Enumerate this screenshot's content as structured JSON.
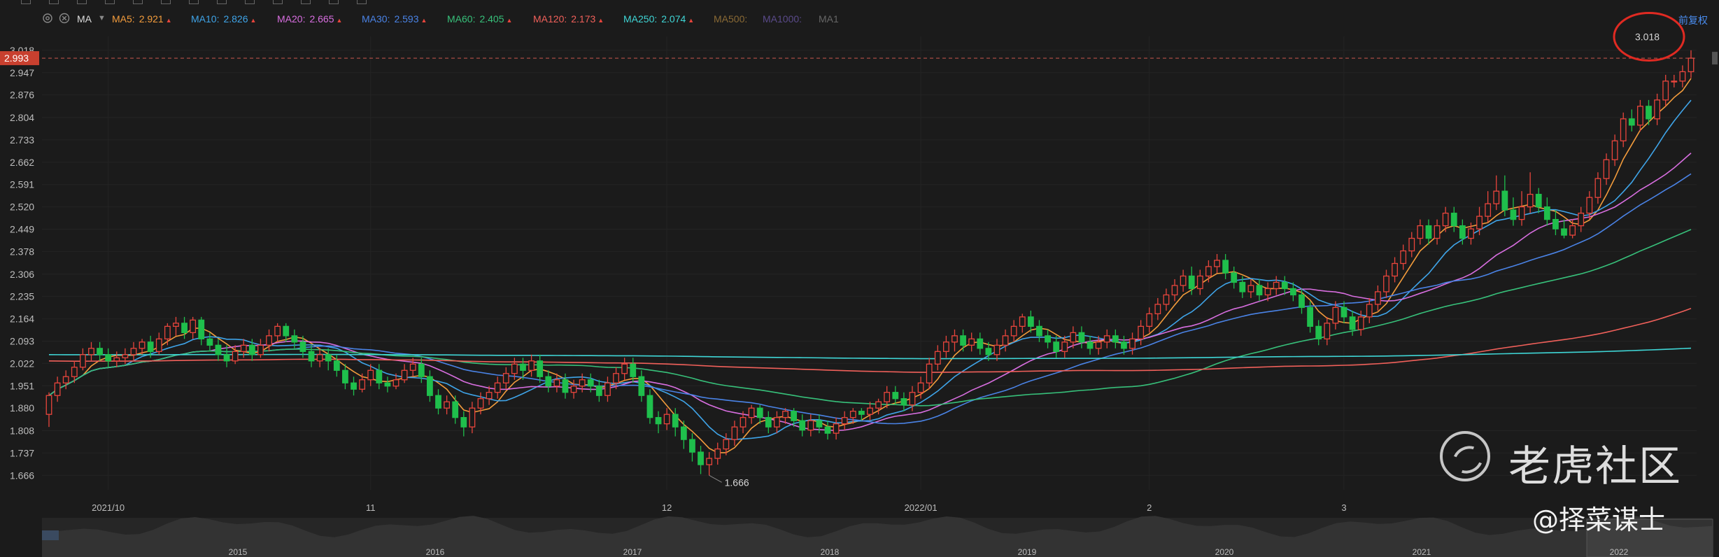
{
  "toolbar": {
    "icons": [
      "pointer-icon",
      "line-icon",
      "trend-icon",
      "shape-icon",
      "text-icon",
      "measure-icon",
      "brush-icon",
      "ruler-icon",
      "zoom-icon",
      "magnet-icon",
      "lock-icon",
      "eye-icon",
      "trash-icon"
    ]
  },
  "ma_bar": {
    "indicator": "MA",
    "items": [
      {
        "label": "MA5:",
        "value": "2.921",
        "color": "#f39c3c",
        "arrow": true
      },
      {
        "label": "MA10:",
        "value": "2.826",
        "color": "#3fa4e8",
        "arrow": true
      },
      {
        "label": "MA20:",
        "value": "2.665",
        "color": "#d86ee0",
        "arrow": true
      },
      {
        "label": "MA30:",
        "value": "2.593",
        "color": "#4a83e6",
        "arrow": true
      },
      {
        "label": "MA60:",
        "value": "2.405",
        "color": "#37c07a",
        "arrow": true
      },
      {
        "label": "MA120:",
        "value": "2.173",
        "color": "#f0605a",
        "arrow": true
      },
      {
        "label": "MA250:",
        "value": "2.074",
        "color": "#3fd6d6",
        "arrow": true
      },
      {
        "label": "MA500:",
        "value": "",
        "color": "#8a6a35",
        "arrow": false
      },
      {
        "label": "MA1000:",
        "value": "",
        "color": "#5a4a8a",
        "arrow": false
      },
      {
        "label": "MA1",
        "value": "",
        "color": "#666666",
        "arrow": false
      }
    ],
    "adjust_label": "前复权"
  },
  "chart_data": {
    "type": "candlestick",
    "yaxis_ticks": [
      "3.018",
      "2.947",
      "2.876",
      "2.804",
      "2.733",
      "2.662",
      "2.591",
      "2.520",
      "2.449",
      "2.378",
      "2.306",
      "2.235",
      "2.164",
      "2.093",
      "2.022",
      "1.951",
      "1.880",
      "1.808",
      "1.737",
      "1.666"
    ],
    "ylim": [
      1.62,
      3.04
    ],
    "current_price": "2.993",
    "high_label": "3.018",
    "low_label": "1.666",
    "xaxis_ticks": [
      {
        "label": "2021/10",
        "index": 7
      },
      {
        "label": "11",
        "index": 38
      },
      {
        "label": "12",
        "index": 73
      },
      {
        "label": "2022/01",
        "index": 103
      },
      {
        "label": "2",
        "index": 130
      },
      {
        "label": "3",
        "index": 153
      }
    ],
    "navigator_ticks": [
      "2015",
      "2016",
      "2017",
      "2018",
      "2019",
      "2020",
      "2021",
      "2022"
    ],
    "series_colors": {
      "up": "#e8453c",
      "down": "#1fbf4c"
    },
    "candles": [
      [
        1.86,
        1.92,
        1.82,
        1.93
      ],
      [
        1.92,
        1.96,
        1.9,
        1.98
      ],
      [
        1.96,
        1.98,
        1.94,
        2.0
      ],
      [
        1.98,
        2.01,
        1.96,
        2.03
      ],
      [
        2.01,
        2.05,
        2.0,
        2.07
      ],
      [
        2.05,
        2.07,
        2.03,
        2.09
      ],
      [
        2.07,
        2.05,
        2.03,
        2.09
      ],
      [
        2.05,
        2.03,
        2.01,
        2.07
      ],
      [
        2.03,
        2.04,
        2.01,
        2.06
      ],
      [
        2.04,
        2.05,
        2.02,
        2.07
      ],
      [
        2.05,
        2.07,
        2.03,
        2.09
      ],
      [
        2.07,
        2.09,
        2.05,
        2.1
      ],
      [
        2.09,
        2.06,
        2.04,
        2.11
      ],
      [
        2.06,
        2.1,
        2.05,
        2.12
      ],
      [
        2.1,
        2.14,
        2.08,
        2.15
      ],
      [
        2.14,
        2.15,
        2.11,
        2.17
      ],
      [
        2.15,
        2.12,
        2.1,
        2.17
      ],
      [
        2.12,
        2.16,
        2.1,
        2.17
      ],
      [
        2.16,
        2.1,
        2.08,
        2.17
      ],
      [
        2.1,
        2.08,
        2.06,
        2.12
      ],
      [
        2.08,
        2.05,
        2.03,
        2.1
      ],
      [
        2.05,
        2.03,
        2.01,
        2.08
      ],
      [
        2.03,
        2.06,
        2.02,
        2.08
      ],
      [
        2.06,
        2.08,
        2.04,
        2.1
      ],
      [
        2.08,
        2.05,
        2.03,
        2.1
      ],
      [
        2.05,
        2.08,
        2.04,
        2.1
      ],
      [
        2.08,
        2.11,
        2.06,
        2.13
      ],
      [
        2.11,
        2.14,
        2.09,
        2.15
      ],
      [
        2.14,
        2.11,
        2.09,
        2.15
      ],
      [
        2.11,
        2.09,
        2.07,
        2.13
      ],
      [
        2.09,
        2.06,
        2.04,
        2.11
      ],
      [
        2.06,
        2.03,
        2.01,
        2.08
      ],
      [
        2.03,
        2.05,
        2.01,
        2.07
      ],
      [
        2.05,
        2.03,
        2.0,
        2.07
      ],
      [
        2.03,
        2.0,
        1.98,
        2.05
      ],
      [
        2.0,
        1.96,
        1.94,
        2.02
      ],
      [
        1.96,
        1.94,
        1.92,
        1.98
      ],
      [
        1.94,
        1.97,
        1.93,
        1.99
      ],
      [
        1.97,
        2.0,
        1.95,
        2.02
      ],
      [
        2.0,
        1.96,
        1.94,
        2.02
      ],
      [
        1.96,
        1.95,
        1.93,
        1.98
      ],
      [
        1.95,
        1.97,
        1.94,
        1.99
      ],
      [
        1.97,
        2.0,
        1.96,
        2.02
      ],
      [
        2.0,
        2.02,
        1.98,
        2.04
      ],
      [
        2.02,
        1.98,
        1.96,
        2.04
      ],
      [
        1.98,
        1.92,
        1.9,
        2.0
      ],
      [
        1.92,
        1.88,
        1.86,
        1.94
      ],
      [
        1.88,
        1.9,
        1.86,
        1.92
      ],
      [
        1.9,
        1.85,
        1.83,
        1.92
      ],
      [
        1.85,
        1.82,
        1.79,
        1.87
      ],
      [
        1.82,
        1.88,
        1.8,
        1.9
      ],
      [
        1.88,
        1.91,
        1.86,
        1.93
      ],
      [
        1.91,
        1.93,
        1.89,
        1.95
      ],
      [
        1.93,
        1.96,
        1.91,
        1.98
      ],
      [
        1.96,
        1.99,
        1.94,
        2.01
      ],
      [
        1.99,
        2.02,
        1.97,
        2.04
      ],
      [
        2.02,
        2.0,
        1.97,
        2.04
      ],
      [
        2.0,
        2.03,
        1.98,
        2.05
      ],
      [
        2.03,
        1.98,
        1.96,
        2.05
      ],
      [
        1.98,
        1.95,
        1.93,
        2.0
      ],
      [
        1.95,
        1.97,
        1.93,
        1.99
      ],
      [
        1.97,
        1.93,
        1.91,
        1.99
      ],
      [
        1.93,
        1.95,
        1.91,
        1.97
      ],
      [
        1.95,
        1.97,
        1.93,
        1.99
      ],
      [
        1.97,
        1.95,
        1.93,
        1.99
      ],
      [
        1.95,
        1.92,
        1.9,
        1.97
      ],
      [
        1.92,
        1.96,
        1.9,
        1.98
      ],
      [
        1.96,
        1.99,
        1.94,
        2.01
      ],
      [
        1.99,
        2.02,
        1.97,
        2.04
      ],
      [
        2.02,
        1.98,
        1.96,
        2.04
      ],
      [
        1.98,
        1.92,
        1.9,
        2.0
      ],
      [
        1.92,
        1.85,
        1.83,
        1.94
      ],
      [
        1.85,
        1.83,
        1.8,
        1.87
      ],
      [
        1.83,
        1.86,
        1.81,
        1.88
      ],
      [
        1.86,
        1.82,
        1.79,
        1.88
      ],
      [
        1.82,
        1.78,
        1.75,
        1.84
      ],
      [
        1.78,
        1.74,
        1.71,
        1.8
      ],
      [
        1.74,
        1.7,
        1.67,
        1.76
      ],
      [
        1.7,
        1.72,
        1.666,
        1.74
      ],
      [
        1.72,
        1.75,
        1.7,
        1.77
      ],
      [
        1.75,
        1.78,
        1.73,
        1.8
      ],
      [
        1.78,
        1.82,
        1.76,
        1.84
      ],
      [
        1.82,
        1.85,
        1.8,
        1.87
      ],
      [
        1.85,
        1.88,
        1.83,
        1.89
      ],
      [
        1.88,
        1.85,
        1.83,
        1.89
      ],
      [
        1.85,
        1.82,
        1.8,
        1.87
      ],
      [
        1.82,
        1.85,
        1.8,
        1.87
      ],
      [
        1.85,
        1.87,
        1.83,
        1.88
      ],
      [
        1.87,
        1.84,
        1.82,
        1.88
      ],
      [
        1.84,
        1.81,
        1.79,
        1.86
      ],
      [
        1.81,
        1.84,
        1.79,
        1.86
      ],
      [
        1.84,
        1.82,
        1.8,
        1.86
      ],
      [
        1.82,
        1.8,
        1.78,
        1.84
      ],
      [
        1.8,
        1.83,
        1.78,
        1.85
      ],
      [
        1.83,
        1.85,
        1.81,
        1.87
      ],
      [
        1.85,
        1.87,
        1.83,
        1.88
      ],
      [
        1.87,
        1.86,
        1.84,
        1.88
      ],
      [
        1.86,
        1.88,
        1.84,
        1.9
      ],
      [
        1.88,
        1.9,
        1.86,
        1.91
      ],
      [
        1.9,
        1.93,
        1.88,
        1.95
      ],
      [
        1.93,
        1.91,
        1.89,
        1.95
      ],
      [
        1.91,
        1.89,
        1.87,
        1.93
      ],
      [
        1.89,
        1.93,
        1.87,
        1.95
      ],
      [
        1.93,
        1.96,
        1.91,
        1.98
      ],
      [
        1.96,
        2.02,
        1.94,
        2.04
      ],
      [
        2.02,
        2.06,
        2.0,
        2.08
      ],
      [
        2.06,
        2.09,
        2.04,
        2.11
      ],
      [
        2.09,
        2.11,
        2.06,
        2.13
      ],
      [
        2.11,
        2.08,
        2.06,
        2.13
      ],
      [
        2.08,
        2.1,
        2.06,
        2.12
      ],
      [
        2.1,
        2.07,
        2.05,
        2.12
      ],
      [
        2.07,
        2.05,
        2.03,
        2.09
      ],
      [
        2.05,
        2.08,
        2.03,
        2.1
      ],
      [
        2.08,
        2.11,
        2.06,
        2.13
      ],
      [
        2.11,
        2.14,
        2.09,
        2.16
      ],
      [
        2.14,
        2.17,
        2.12,
        2.18
      ],
      [
        2.17,
        2.14,
        2.12,
        2.19
      ],
      [
        2.14,
        2.11,
        2.09,
        2.16
      ],
      [
        2.11,
        2.09,
        2.07,
        2.13
      ],
      [
        2.09,
        2.06,
        2.04,
        2.11
      ],
      [
        2.06,
        2.09,
        2.04,
        2.11
      ],
      [
        2.09,
        2.12,
        2.07,
        2.14
      ],
      [
        2.12,
        2.09,
        2.07,
        2.14
      ],
      [
        2.09,
        2.07,
        2.05,
        2.11
      ],
      [
        2.07,
        2.09,
        2.05,
        2.11
      ],
      [
        2.09,
        2.11,
        2.07,
        2.13
      ],
      [
        2.11,
        2.09,
        2.07,
        2.13
      ],
      [
        2.09,
        2.07,
        2.05,
        2.11
      ],
      [
        2.07,
        2.1,
        2.05,
        2.12
      ],
      [
        2.1,
        2.14,
        2.08,
        2.16
      ],
      [
        2.14,
        2.18,
        2.12,
        2.2
      ],
      [
        2.18,
        2.21,
        2.16,
        2.23
      ],
      [
        2.21,
        2.24,
        2.19,
        2.26
      ],
      [
        2.24,
        2.27,
        2.22,
        2.29
      ],
      [
        2.27,
        2.3,
        2.25,
        2.32
      ],
      [
        2.3,
        2.26,
        2.24,
        2.33
      ],
      [
        2.26,
        2.3,
        2.24,
        2.32
      ],
      [
        2.3,
        2.33,
        2.28,
        2.35
      ],
      [
        2.33,
        2.35,
        2.31,
        2.37
      ],
      [
        2.35,
        2.31,
        2.29,
        2.37
      ],
      [
        2.31,
        2.28,
        2.26,
        2.33
      ],
      [
        2.28,
        2.25,
        2.23,
        2.3
      ],
      [
        2.25,
        2.27,
        2.23,
        2.29
      ],
      [
        2.27,
        2.24,
        2.22,
        2.29
      ],
      [
        2.24,
        2.26,
        2.22,
        2.28
      ],
      [
        2.26,
        2.28,
        2.24,
        2.3
      ],
      [
        2.28,
        2.26,
        2.24,
        2.3
      ],
      [
        2.26,
        2.24,
        2.22,
        2.28
      ],
      [
        2.24,
        2.2,
        2.18,
        2.26
      ],
      [
        2.2,
        2.14,
        2.12,
        2.22
      ],
      [
        2.14,
        2.1,
        2.08,
        2.16
      ],
      [
        2.1,
        2.15,
        2.08,
        2.17
      ],
      [
        2.15,
        2.2,
        2.13,
        2.22
      ],
      [
        2.2,
        2.17,
        2.15,
        2.22
      ],
      [
        2.17,
        2.13,
        2.11,
        2.19
      ],
      [
        2.13,
        2.17,
        2.11,
        2.19
      ],
      [
        2.17,
        2.21,
        2.15,
        2.23
      ],
      [
        2.21,
        2.25,
        2.19,
        2.27
      ],
      [
        2.25,
        2.3,
        2.23,
        2.32
      ],
      [
        2.3,
        2.34,
        2.28,
        2.36
      ],
      [
        2.34,
        2.38,
        2.32,
        2.4
      ],
      [
        2.38,
        2.42,
        2.36,
        2.44
      ],
      [
        2.42,
        2.46,
        2.4,
        2.48
      ],
      [
        2.46,
        2.42,
        2.4,
        2.48
      ],
      [
        2.42,
        2.46,
        2.4,
        2.48
      ],
      [
        2.46,
        2.5,
        2.44,
        2.52
      ],
      [
        2.5,
        2.46,
        2.44,
        2.52
      ],
      [
        2.46,
        2.42,
        2.4,
        2.48
      ],
      [
        2.42,
        2.45,
        2.4,
        2.47
      ],
      [
        2.45,
        2.49,
        2.43,
        2.52
      ],
      [
        2.49,
        2.53,
        2.47,
        2.57
      ],
      [
        2.53,
        2.57,
        2.51,
        2.62
      ],
      [
        2.57,
        2.51,
        2.49,
        2.62
      ],
      [
        2.51,
        2.48,
        2.46,
        2.55
      ],
      [
        2.48,
        2.52,
        2.46,
        2.57
      ],
      [
        2.52,
        2.56,
        2.5,
        2.63
      ],
      [
        2.56,
        2.52,
        2.5,
        2.58
      ],
      [
        2.52,
        2.48,
        2.46,
        2.55
      ],
      [
        2.48,
        2.45,
        2.43,
        2.51
      ],
      [
        2.45,
        2.43,
        2.42,
        2.48
      ],
      [
        2.43,
        2.46,
        2.42,
        2.48
      ],
      [
        2.46,
        2.5,
        2.44,
        2.52
      ],
      [
        2.5,
        2.55,
        2.48,
        2.57
      ],
      [
        2.55,
        2.61,
        2.53,
        2.63
      ],
      [
        2.61,
        2.67,
        2.59,
        2.69
      ],
      [
        2.67,
        2.73,
        2.65,
        2.75
      ],
      [
        2.73,
        2.8,
        2.71,
        2.82
      ],
      [
        2.8,
        2.78,
        2.76,
        2.83
      ],
      [
        2.78,
        2.84,
        2.76,
        2.86
      ],
      [
        2.84,
        2.8,
        2.78,
        2.86
      ],
      [
        2.8,
        2.86,
        2.78,
        2.88
      ],
      [
        2.86,
        2.92,
        2.84,
        2.94
      ],
      [
        2.92,
        2.92,
        2.9,
        2.94
      ],
      [
        2.92,
        2.95,
        2.9,
        2.97
      ],
      [
        2.95,
        2.993,
        2.93,
        3.018
      ]
    ]
  },
  "watermark": {
    "brand": "老虎社区",
    "author": "@择菜谋士"
  }
}
